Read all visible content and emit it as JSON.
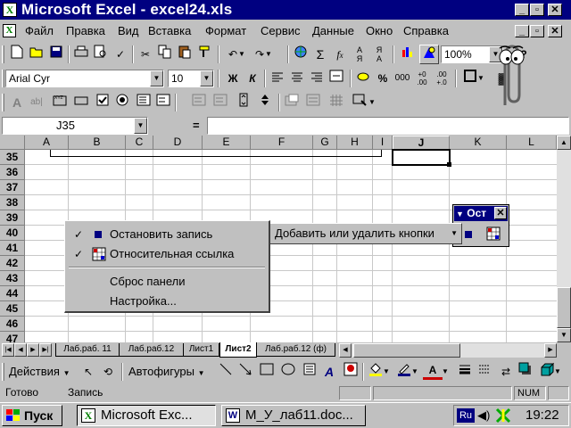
{
  "window": {
    "title": "Microsoft Excel - excel24.xls",
    "icon": "excel-icon"
  },
  "menu": [
    "Файл",
    "Правка",
    "Вид",
    "Вставка",
    "Формат",
    "Сервис",
    "Данные",
    "Окно",
    "Справка"
  ],
  "standard_toolbar": {
    "zoom": "100%"
  },
  "formatting_toolbar": {
    "font": "Arial Cyr",
    "size": "10",
    "bold": "Ж",
    "italic": "К",
    "thousands": "000"
  },
  "formula_bar": {
    "name_box": "J35",
    "equals": "="
  },
  "columns": [
    "A",
    "B",
    "C",
    "D",
    "E",
    "F",
    "G",
    "H",
    "I",
    "J",
    "K",
    "L"
  ],
  "rows": [
    "35",
    "36",
    "37",
    "38",
    "39",
    "40",
    "41",
    "42",
    "43",
    "44",
    "45",
    "46",
    "47"
  ],
  "active_cell": "J35",
  "popup_menu": {
    "items": [
      {
        "label": "Остановить запись",
        "checked": true,
        "icon": "stop-square-icon"
      },
      {
        "label": "Относительная ссылка",
        "checked": true,
        "icon": "relative-ref-icon"
      },
      {
        "label": "Сброс панели"
      },
      {
        "label": "Настройка..."
      }
    ],
    "add_remove_button": "Добавить или удалить кнопки"
  },
  "floating_toolbar": {
    "title": "Ост",
    "close": "✕"
  },
  "sheet_tabs": [
    "Лаб.раб. 11",
    "Лаб.раб.12",
    "Лист1",
    "Лист2",
    "Лаб.раб.12 (ф)"
  ],
  "active_sheet": "Лист2",
  "drawing_toolbar": {
    "actions": "Действия",
    "autoshapes": "Автофигуры"
  },
  "status_bar": {
    "ready": "Готово",
    "record": "Запись",
    "num": "NUM"
  },
  "taskbar": {
    "start": "Пуск",
    "tasks": [
      "Microsoft Exc...",
      "М_У_лаб11.doc..."
    ],
    "lang": "Ru",
    "clock": "19:22"
  },
  "colors": {
    "title_bg": "#000080",
    "face": "#c0c0c0",
    "grid": "#c8c8c8"
  }
}
